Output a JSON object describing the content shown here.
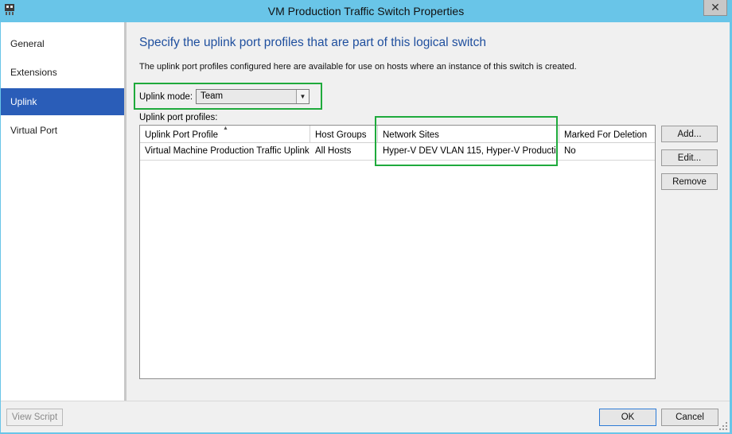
{
  "window": {
    "title": "VM Production Traffic Switch Properties",
    "close_symbol": "✕"
  },
  "sidebar": {
    "items": [
      {
        "label": "General"
      },
      {
        "label": "Extensions"
      },
      {
        "label": "Uplink",
        "selected": true
      },
      {
        "label": "Virtual Port"
      }
    ]
  },
  "uplink": {
    "heading": "Specify the uplink port profiles that are part of this logical switch",
    "description": "The uplink port profiles configured here are available for use on hosts where an instance of this switch is created.",
    "mode_label": "Uplink mode:",
    "mode_value": "Team",
    "profiles_label": "Uplink port profiles:",
    "columns": [
      "Uplink Port Profile",
      "Host Groups",
      "Network Sites",
      "Marked For Deletion"
    ],
    "rows": [
      {
        "profile": "Virtual Machine Production Traffic Uplink",
        "host_groups": "All Hosts",
        "network_sites": "Hyper-V DEV VLAN 115, Hyper-V Producti...",
        "marked_for_deletion": "No"
      }
    ],
    "buttons": {
      "add": "Add...",
      "edit": "Edit...",
      "remove": "Remove"
    }
  },
  "footer": {
    "view_script": "View Script",
    "ok": "OK",
    "cancel": "Cancel"
  },
  "colors": {
    "titlebar": "#69c5e8",
    "selected_nav": "#2a5db8",
    "heading": "#1f4f9e",
    "highlight_box": "#1faa3c"
  }
}
